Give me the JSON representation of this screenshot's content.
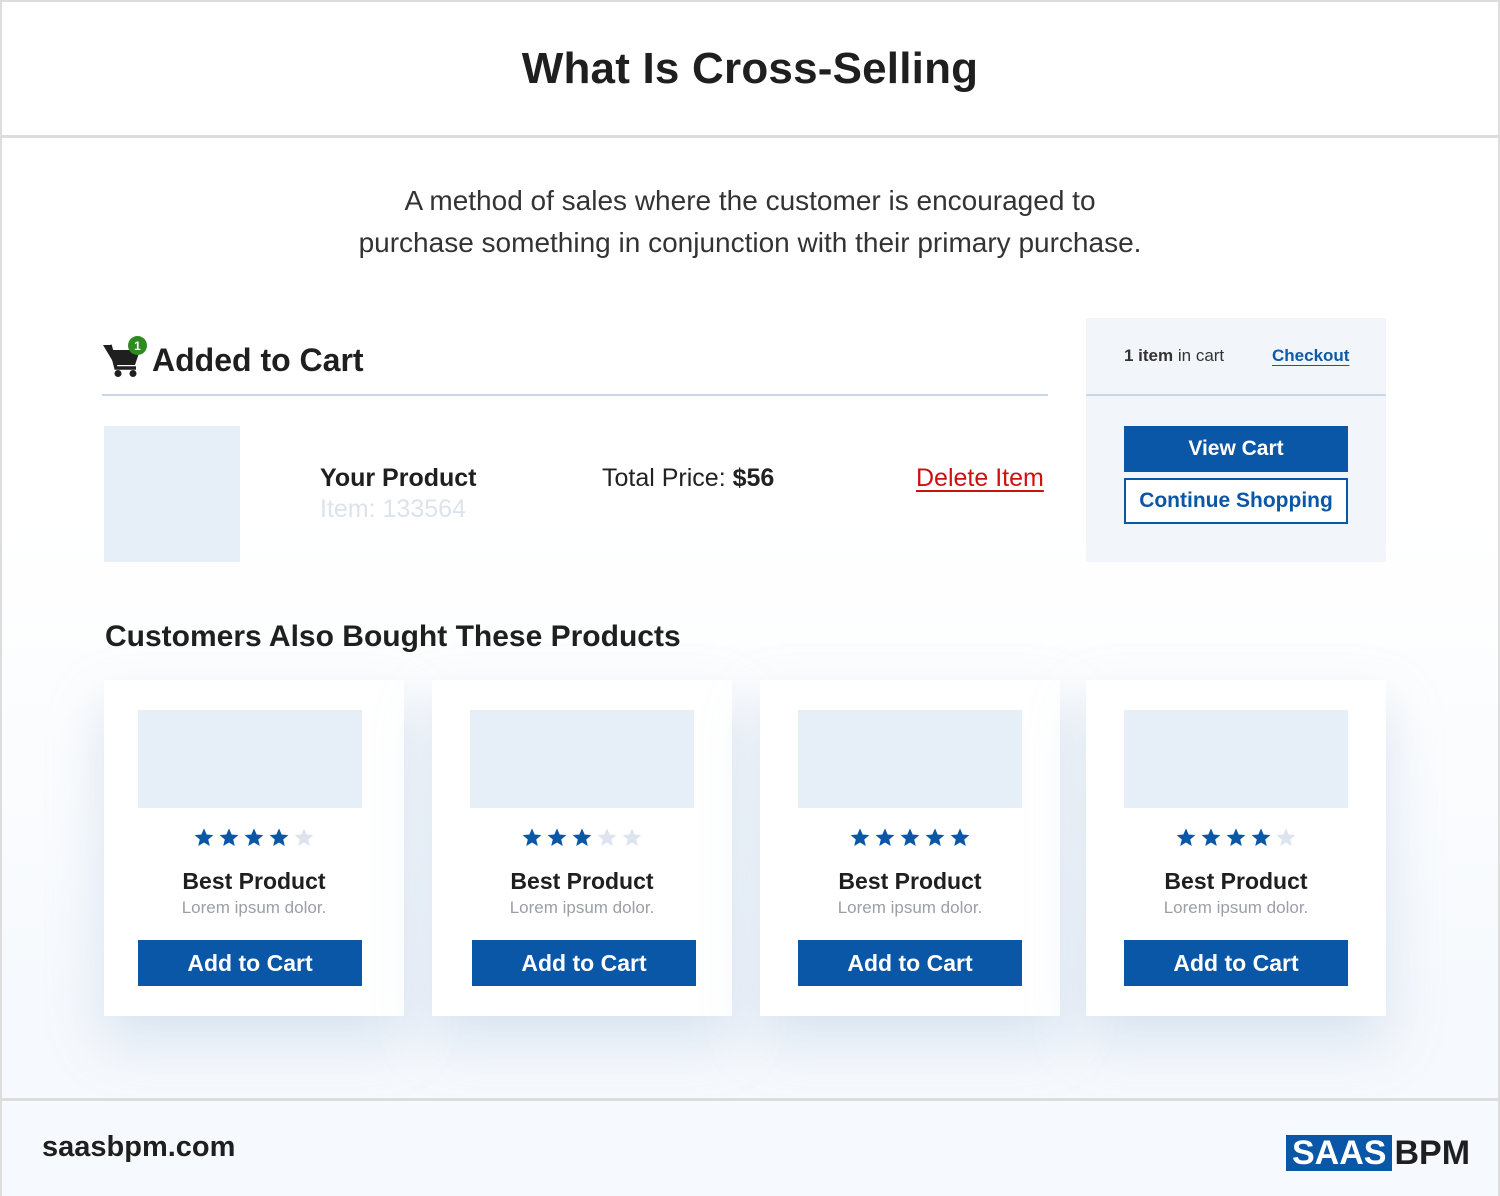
{
  "header": {
    "title": "What Is Cross-Selling"
  },
  "subtitle": {
    "line1": "A method of sales where the customer is encouraged to",
    "line2": "purchase something in conjunction with their primary purchase."
  },
  "added_to_cart": {
    "badge_count": "1",
    "title": "Added to Cart",
    "product_name": "Your Product",
    "product_item": "Item: 133564",
    "total_label": "Total Price: ",
    "total_value": "$56",
    "delete_label": "Delete Item"
  },
  "cart_panel": {
    "count_bold": "1 item",
    "count_rest": " in cart",
    "checkout_label": "Checkout",
    "view_cart_label": "View Cart",
    "continue_label": "Continue Shopping"
  },
  "recommendations": {
    "title": "Customers Also Bought These Products",
    "cards": [
      {
        "rating": 4,
        "max_rating": 5,
        "title": "Best Product",
        "desc": "Lorem ipsum dolor.",
        "button": "Add to Cart"
      },
      {
        "rating": 3,
        "max_rating": 5,
        "title": "Best Product",
        "desc": "Lorem ipsum dolor.",
        "button": "Add to Cart"
      },
      {
        "rating": 5,
        "max_rating": 5,
        "title": "Best Product",
        "desc": "Lorem ipsum dolor.",
        "button": "Add to Cart"
      },
      {
        "rating": 4,
        "max_rating": 5,
        "title": "Best Product",
        "desc": "Lorem ipsum dolor.",
        "button": "Add to Cart"
      }
    ]
  },
  "footer": {
    "site": "saasbpm.com",
    "logo_part1": "SAAS",
    "logo_part2": "BPM"
  },
  "colors": {
    "accent": "#0b57a7",
    "delete": "#cc1111",
    "badge": "#2e8b1f",
    "star_filled": "#0b57a7",
    "star_empty": "#dde4ee"
  },
  "icons": {
    "cart": "shopping-cart-icon",
    "star": "star-icon"
  }
}
